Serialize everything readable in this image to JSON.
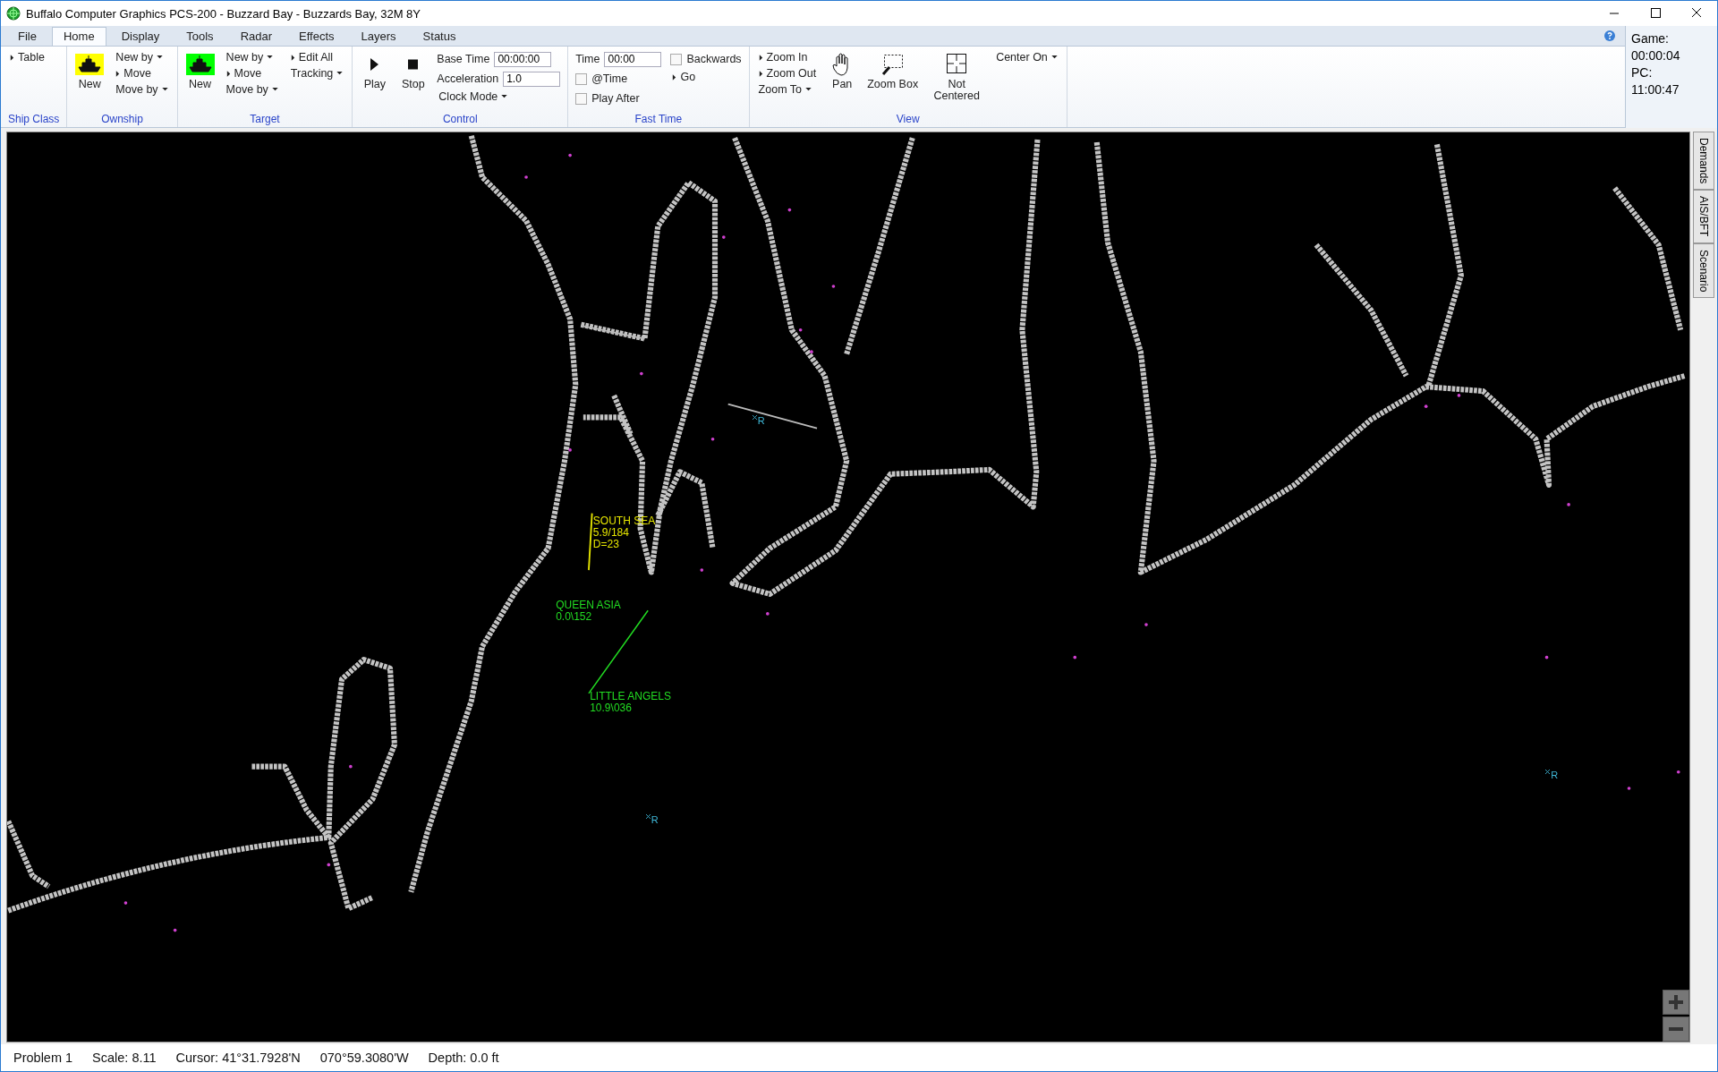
{
  "window": {
    "title": "Buffalo Computer Graphics PCS-200 - Buzzard Bay - Buzzards Bay, 32M 8Y"
  },
  "tabs": [
    {
      "label": "File",
      "selected": false
    },
    {
      "label": "Home",
      "selected": true
    },
    {
      "label": "Display",
      "selected": false
    },
    {
      "label": "Tools",
      "selected": false
    },
    {
      "label": "Radar",
      "selected": false
    },
    {
      "label": "Effects",
      "selected": false
    },
    {
      "label": "Layers",
      "selected": false
    },
    {
      "label": "Status",
      "selected": false
    }
  ],
  "ribbon": {
    "groups": [
      {
        "label": "Ship Class",
        "columns": [
          [
            {
              "kind": "arrow",
              "label": "Table"
            }
          ]
        ]
      },
      {
        "label": "Ownship",
        "columns": [
          [
            {
              "kind": "ship",
              "color": "#ffff00",
              "label": "New"
            }
          ],
          [
            {
              "kind": "dropdown",
              "label": "New by"
            },
            {
              "kind": "arrow",
              "label": "Move"
            },
            {
              "kind": "dropdown",
              "label": "Move by"
            }
          ]
        ]
      },
      {
        "label": "Target",
        "columns": [
          [
            {
              "kind": "ship",
              "color": "#00ff00",
              "label": "New"
            }
          ],
          [
            {
              "kind": "dropdown",
              "label": "New by"
            },
            {
              "kind": "arrow",
              "label": "Move"
            },
            {
              "kind": "dropdown",
              "label": "Move by"
            }
          ],
          [
            {
              "kind": "arrow",
              "label": "Edit All"
            },
            {
              "kind": "dropdown",
              "label": "Tracking"
            }
          ]
        ]
      },
      {
        "label": "Control",
        "columns": [
          [
            {
              "kind": "play",
              "label": "Play"
            }
          ],
          [
            {
              "kind": "stop",
              "label": "Stop"
            }
          ],
          [
            {
              "kind": "field",
              "label": "Base Time",
              "value": "00:00:00"
            },
            {
              "kind": "field",
              "label": "Acceleration",
              "value": "1.0"
            },
            {
              "kind": "dropdown",
              "label": "Clock Mode"
            }
          ]
        ]
      },
      {
        "label": "Fast Time",
        "columns": [
          [
            {
              "kind": "field",
              "label": "Time",
              "value": "00:00"
            },
            {
              "kind": "checkbox",
              "label": "@Time",
              "checked": false
            },
            {
              "kind": "checkbox",
              "label": "Play After",
              "checked": false
            }
          ],
          [
            {
              "kind": "checkbox",
              "label": "Backwards",
              "checked": false
            },
            {
              "kind": "arrow",
              "label": "Go"
            }
          ]
        ]
      },
      {
        "label": "View",
        "columns": [
          [
            {
              "kind": "arrow",
              "label": "Zoom In"
            },
            {
              "kind": "arrow",
              "label": "Zoom Out"
            },
            {
              "kind": "dropdown",
              "label": "Zoom To"
            }
          ],
          [
            {
              "kind": "pan",
              "label": "Pan"
            }
          ],
          [
            {
              "kind": "zoombox",
              "label": "Zoom Box"
            }
          ],
          [
            {
              "kind": "crosshair",
              "label": "Not Centered"
            }
          ],
          [
            {
              "kind": "dropdown",
              "label": "Center On"
            }
          ]
        ]
      }
    ]
  },
  "clock": [
    "Game:",
    "00:00:04",
    "PC:",
    "11:00:47"
  ],
  "side_tabs": [
    "Demands",
    "AIS/BFT",
    "Scenario"
  ],
  "map": {
    "contacts": [
      {
        "color": "#e6e600",
        "lines": [
          "SOUTH SEA",
          "5.9/184",
          "D=23"
        ]
      },
      {
        "color": "#22dd22",
        "lines": [
          "QUEEN ASIA",
          "0.0\\152"
        ]
      },
      {
        "color": "#22dd22",
        "lines": [
          "LITTLE ANGELS",
          "10.9\\036"
        ]
      }
    ],
    "markers": [
      "R",
      "R",
      "R"
    ]
  },
  "status_bar": [
    "Problem 1",
    "Scale: 8.11",
    "Cursor: 41°31.7928'N",
    "070°59.3080'W",
    "Depth: 0.0 ft"
  ]
}
